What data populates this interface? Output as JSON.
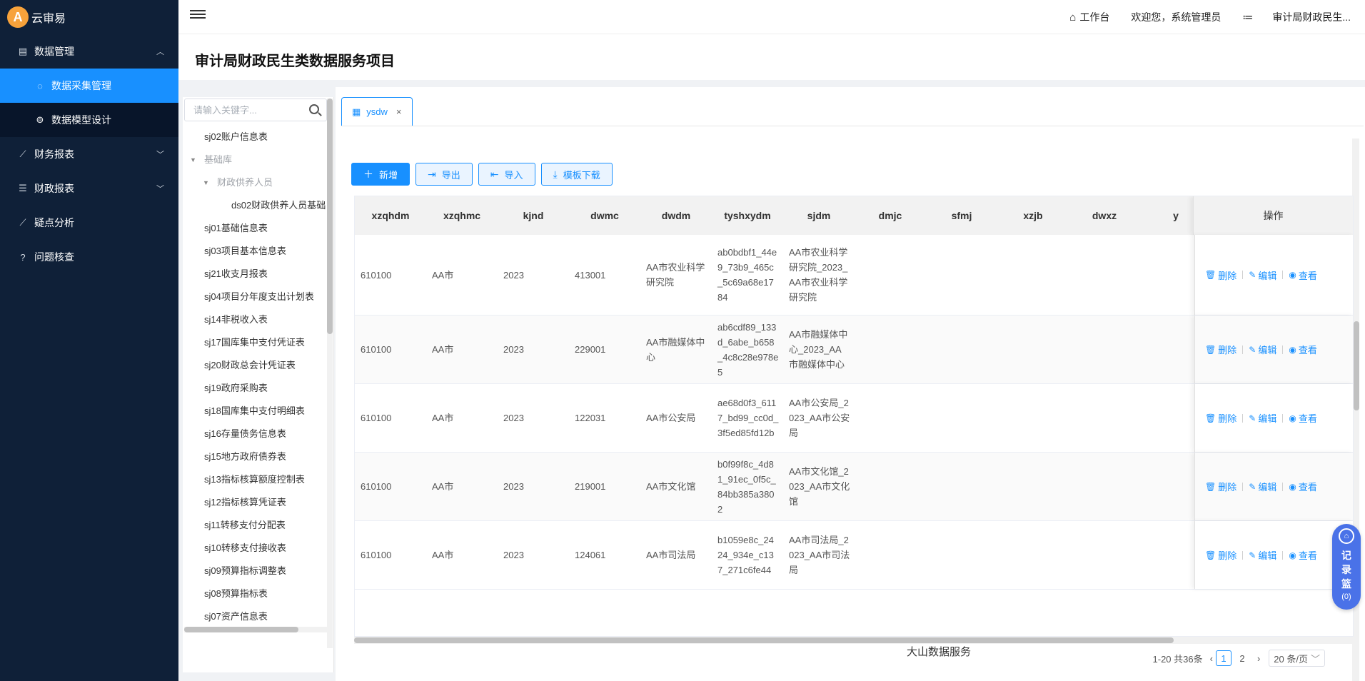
{
  "app": {
    "name": "云审易",
    "logo_glyph": "A"
  },
  "sidebar": {
    "groups": [
      {
        "label": "数据管理",
        "icon": "database-icon",
        "expanded": true,
        "children": [
          {
            "label": "数据采集管理",
            "icon": "flame-icon",
            "active": true
          },
          {
            "label": "数据模型设计",
            "icon": "model-icon",
            "active": false
          }
        ]
      },
      {
        "label": "财务报表",
        "icon": "chart-icon"
      },
      {
        "label": "财政报表",
        "icon": "list-icon"
      },
      {
        "label": "疑点分析",
        "icon": "analysis-icon"
      },
      {
        "label": "问题核查",
        "icon": "question-icon"
      }
    ]
  },
  "header": {
    "workbench": "工作台",
    "welcome": "欢迎您，系统管理员",
    "org": "审计局财政民生..."
  },
  "page": {
    "title": "审计局财政民生类数据服务项目"
  },
  "tree": {
    "search_placeholder": "请输入关键字...",
    "nodes": [
      "sj02账户信息表",
      "基础库",
      "财政供养人员",
      "ds02财政供养人员基础",
      "sj01基础信息表",
      "sj03项目基本信息表",
      "sj21收支月报表",
      "sj04项目分年度支出计划表",
      "sj14非税收入表",
      "sj17国库集中支付凭证表",
      "sj20财政总会计凭证表",
      "sj19政府采购表",
      "sj18国库集中支付明细表",
      "sj16存量债务信息表",
      "sj15地方政府债券表",
      "sj13指标核算额度控制表",
      "sj12指标核算凭证表",
      "sj11转移支付分配表",
      "sj10转移支付接收表",
      "sj09预算指标调整表",
      "sj08预算指标表",
      "sj07资产信息表"
    ]
  },
  "tab": {
    "label": "ysdw",
    "close": "×"
  },
  "toolbar": {
    "add": "新增",
    "export": "导出",
    "import": "导入",
    "template": "模板下载"
  },
  "table": {
    "columns": [
      "xzqhdm",
      "xzqhmc",
      "kjnd",
      "dwmc",
      "dwdm",
      "tyshxydm",
      "sjdm",
      "dmjc",
      "sfmj",
      "xzjb",
      "dwxz",
      "y"
    ],
    "ops_header": "操作",
    "ops": {
      "delete": "删除",
      "edit": "编辑",
      "view": "查看"
    },
    "rows": [
      [
        "610100",
        "AA市",
        "2023",
        "413001",
        "AA市农业科学研究院",
        "ab0bdbf1_44e9_73b9_465c_5c69a68e1784",
        "AA市农业科学研究院_2023_AA市农业科学研究院"
      ],
      [
        "610100",
        "AA市",
        "2023",
        "229001",
        "AA市融媒体中心",
        "ab6cdf89_133d_6abe_b658_4c8c28e978e5",
        "AA市融媒体中心_2023_AA市融媒体中心"
      ],
      [
        "610100",
        "AA市",
        "2023",
        "122031",
        "AA市公安局",
        "ae68d0f3_6117_bd99_cc0d_3f5ed85fd12b",
        "AA市公安局_2023_AA市公安局"
      ],
      [
        "610100",
        "AA市",
        "2023",
        "219001",
        "AA市文化馆",
        "b0f99f8c_4d81_91ec_0f5c_84bb385a3802",
        "AA市文化馆_2023_AA市文化馆"
      ],
      [
        "610100",
        "AA市",
        "2023",
        "124061",
        "AA市司法局",
        "b1059e8c_2424_934e_c137_271c6fe44",
        "AA市司法局_2023_AA市司法局"
      ]
    ]
  },
  "footer": {
    "text": "大山数据服务"
  },
  "pagination": {
    "summary": "1-20 共36条",
    "pages": [
      "1",
      "2"
    ],
    "current": "1",
    "size": "20 条/页"
  },
  "basket": {
    "label_1": "记",
    "label_2": "录",
    "label_3": "篮",
    "count": "(0)"
  },
  "colors": {
    "sidebar_bg": "#0f2038",
    "accent": "#1890ff",
    "basket": "#4a72e8"
  }
}
